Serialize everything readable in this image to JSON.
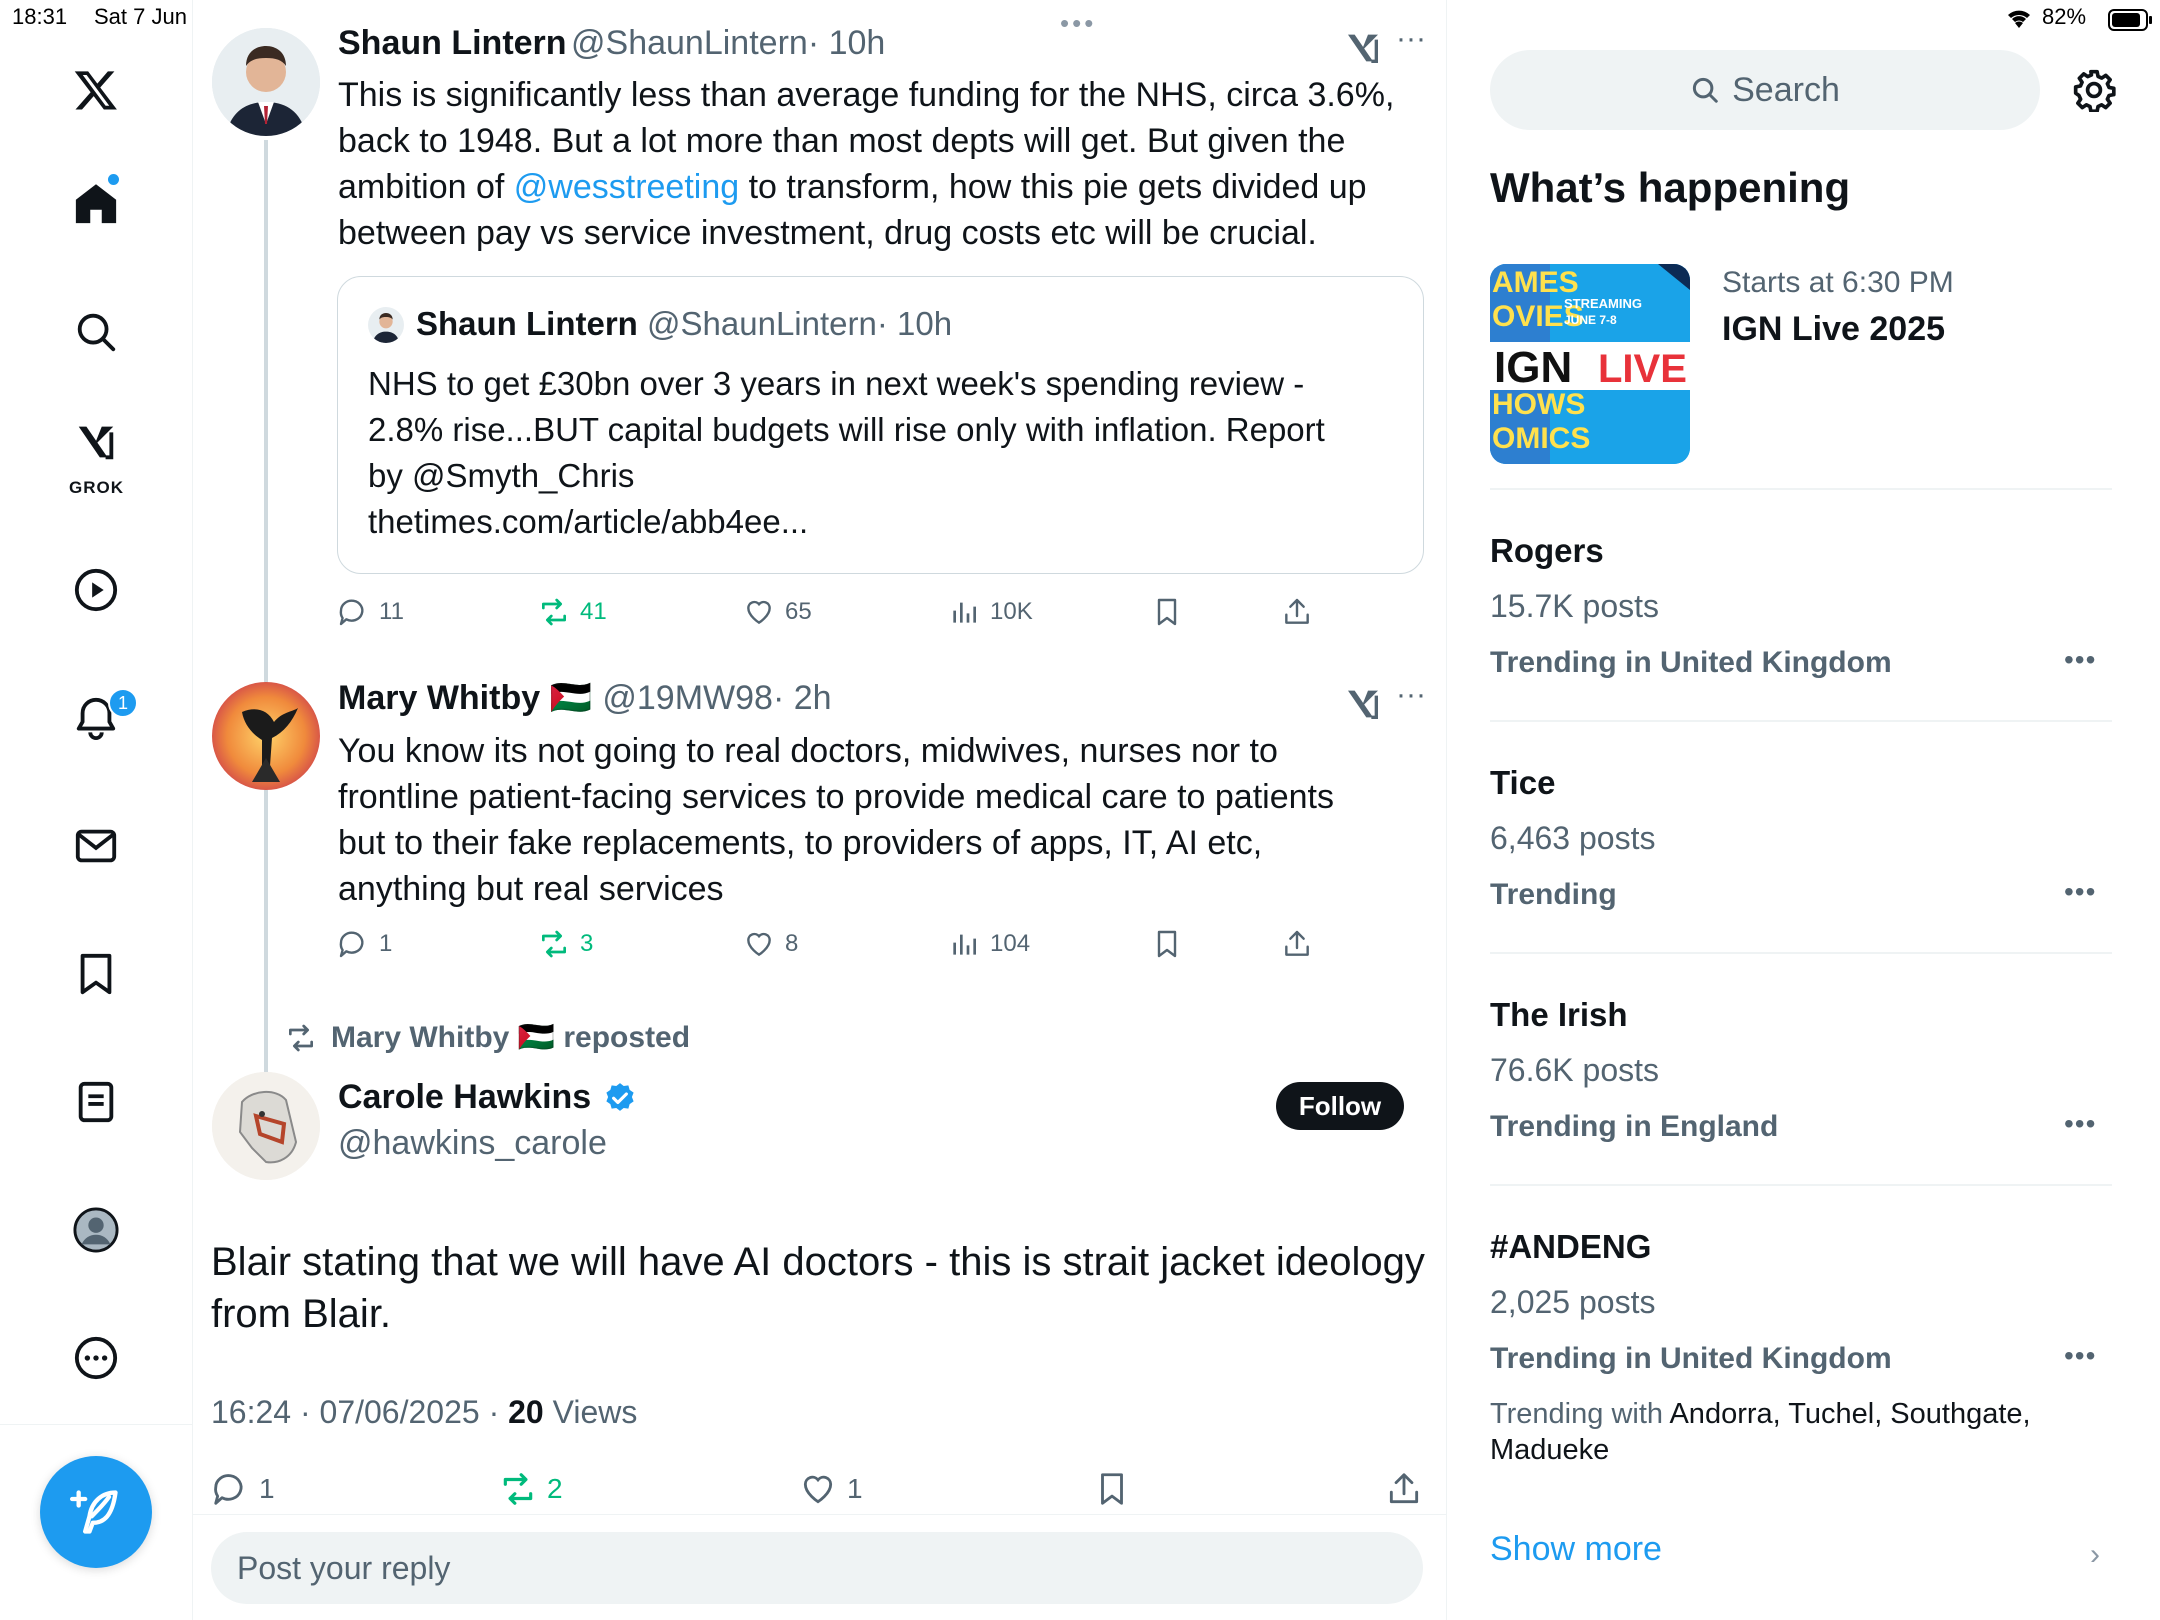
{
  "status_bar": {
    "time": "18:31",
    "date": "Sat 7 Jun",
    "battery": "82%"
  },
  "nav": {
    "grok_label": "GROK",
    "notifications_badge": "1"
  },
  "tweets": [
    {
      "name": "Shaun Lintern",
      "handle": "@ShaunLintern",
      "time": "· 10h",
      "text_lines": [
        "This is significantly less than average funding for the NHS, circa 3.6%,",
        "back to 1948. But a lot more than most depts will get. But given the"
      ],
      "text_line3_pre": "ambition of ",
      "text_line3_mention": "@wesstreeting",
      "text_line3_post": " to transform, how this pie gets divided up",
      "text_line4": "between pay vs service investment, drug costs etc will be crucial.",
      "quote": {
        "name": "Shaun Lintern",
        "handle": "@ShaunLintern",
        "time": "· 10h",
        "lines": [
          "NHS to get £30bn over 3 years in next week's spending review -",
          "2.8% rise...BUT capital budgets will rise only with inflation. Report",
          "by @Smyth_Chris",
          "thetimes.com/article/abb4ee..."
        ]
      },
      "replies": "11",
      "reposts": "41",
      "likes": "65",
      "views": "10K"
    },
    {
      "name": "Mary Whitby 🇵🇸",
      "handle": "@19MW98",
      "time": "· 2h",
      "text_lines": [
        "You know its not going to real doctors, midwives, nurses nor to",
        "frontline patient-facing services to provide medical care to patients",
        "but to their fake replacements, to providers of apps, IT, AI etc,",
        "anything but real services"
      ],
      "replies": "1",
      "reposts": "3",
      "likes": "8",
      "views": "104"
    }
  ],
  "repost_banner": "Mary Whitby 🇵🇸 reposted",
  "focus_tweet": {
    "name": "Carole Hawkins",
    "handle": "@hawkins_carole",
    "follow_label": "Follow",
    "text_lines": [
      "Blair stating that we will have AI doctors - this is strait jacket ideology",
      "from Blair."
    ],
    "timestamp": "16:24 · 07/06/2025 · ",
    "views_count": "20",
    "views_label": " Views",
    "replies": "1",
    "reposts": "2",
    "likes": "1"
  },
  "reply_placeholder": "Post your reply",
  "sidebar": {
    "search_placeholder": "Search",
    "section_title": "What’s happening",
    "event": {
      "starts": "Starts at 6:30 PM",
      "title": "IGN Live 2025",
      "thumb_text_top": "STREAMING JUNE 7-8",
      "thumb_text_main": "IGN LIVE"
    },
    "trends": [
      {
        "name": "Rogers",
        "count": "15.7K posts",
        "context": "Trending in United Kingdom"
      },
      {
        "name": "Tice",
        "count": "6,463 posts",
        "context": "Trending"
      },
      {
        "name": "The Irish",
        "count": "76.6K posts",
        "context": "Trending in England"
      },
      {
        "name": "#ANDENG",
        "count": "2,025 posts",
        "context": "Trending in United Kingdom",
        "with_label": "Trending with ",
        "with_names": "Andorra, Tuchel, Southgate,",
        "with_names2": "Madueke"
      }
    ],
    "show_more": "Show more"
  },
  "colors": {
    "accent": "#1d9bf0",
    "repost_green": "#00ba7c",
    "muted": "#536471",
    "text": "#0f1419"
  }
}
